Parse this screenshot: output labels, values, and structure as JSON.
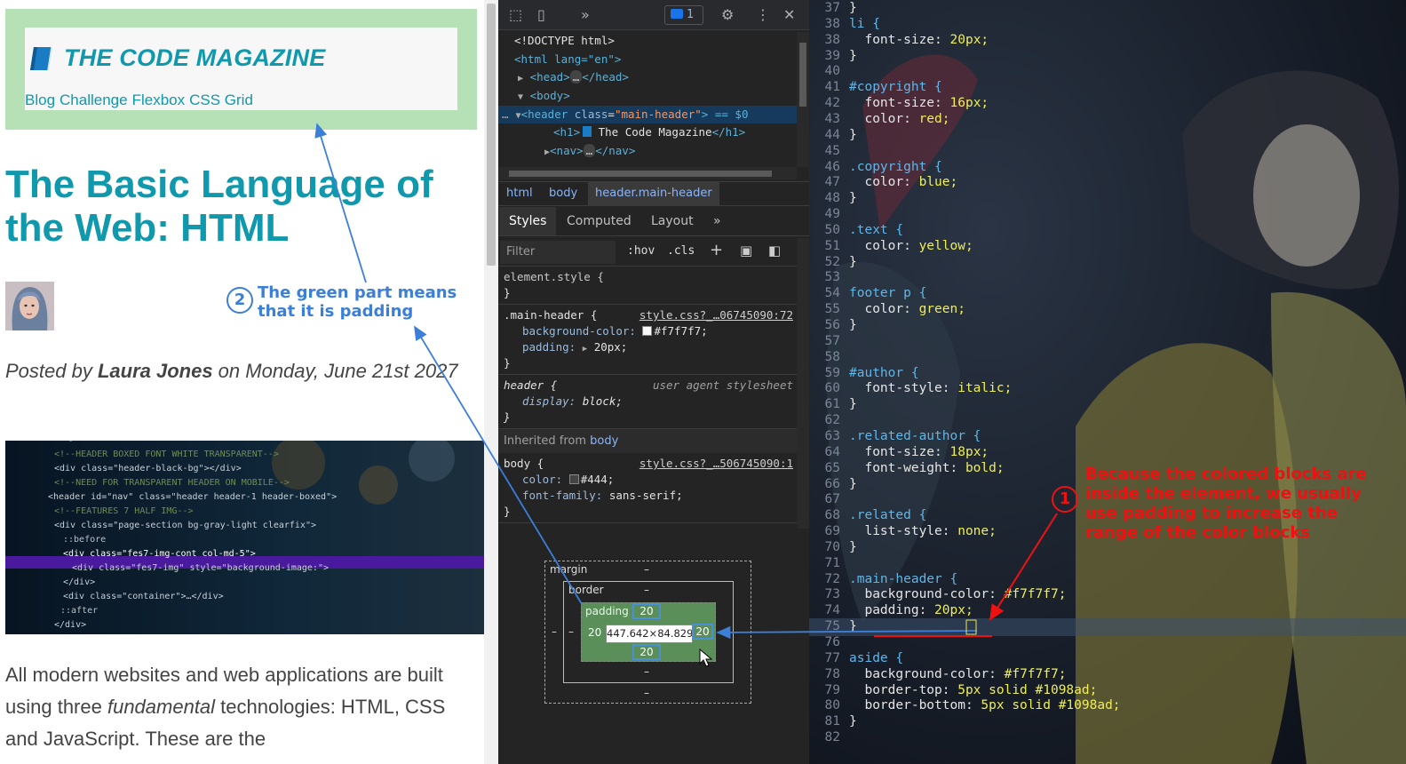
{
  "page": {
    "logo_text": "THE CODE MAGAZINE",
    "nav": [
      "Blog",
      "Challenge",
      "Flexbox",
      "CSS Grid"
    ],
    "title": "The Basic Language of the Web: HTML",
    "posted_prefix": "Posted by ",
    "author": "Laura Jones",
    "posted_suffix": " on Monday, June 21st 2027",
    "body_pre": "All modern websites and web applications are built using three ",
    "body_em": "fundamental",
    "body_post": " technologies: HTML, CSS and JavaScript. These are the",
    "code_image_lines": [
      "-->",
      "<!--HEADER BOXED FONT WHITE TRANSPARENT-->",
      "<div class=\"header-black-bg\"></div>",
      "<!--NEED FOR TRANSPARENT HEADER ON MOBILE-->",
      "<header id=\"nav\" class=\"header header-1 header-boxed\">",
      "<!--FEATURES 7 HALF IMG-->",
      "<div class=\"page-section bg-gray-light clearfix\">",
      "::before",
      "<div class=\"fes7-img-cont col-md-5\">",
      "<div class=\"fes7-img\" style=\"background-image:\">",
      "</div>",
      "<div class=\"container\">…</div>",
      "::after",
      "</div>"
    ]
  },
  "devtools": {
    "issues_count": "1",
    "dom": {
      "doctype": "<!DOCTYPE html>",
      "html_open": "<html lang=\"en\">",
      "head": "<head>",
      "head_close": "</head>",
      "body_open": "<body>",
      "header_tag": "<header",
      "header_attr_name": "class",
      "header_attr_value": "\"main-header\"",
      "header_suffix": "> == $0",
      "h1_open": "<h1>",
      "h1_text": " The Code Magazine",
      "h1_close": "</h1>",
      "nav_open": "<nav>",
      "nav_close": "</nav>",
      "ellipsis": "…"
    },
    "breadcrumbs": [
      "html",
      "body",
      "header.main-header"
    ],
    "tabs": [
      "Styles",
      "Computed",
      "Layout"
    ],
    "filter_placeholder": "Filter",
    "hov": ":hov",
    "cls": ".cls",
    "rules": {
      "element_style": "element.style {",
      "main_header_selector": ".main-header {",
      "main_header_src": "style.css?_…06745090:72",
      "bg_prop": "background-color:",
      "bg_val": "#f7f7f7;",
      "padding_prop": "padding:",
      "padding_val": "20px;",
      "header_selector": "header {",
      "ua_label": "user agent stylesheet",
      "display_prop": "display:",
      "display_val": "block;",
      "inherited_label": "Inherited from ",
      "inherited_from": "body",
      "body_selector": "body {",
      "body_src": "style.css?_…506745090:1",
      "color_prop": "color:",
      "color_val": "#444;",
      "font_prop": "font-family:",
      "font_val": "sans-serif;",
      "close_brace": "}"
    },
    "box_model": {
      "margin_label": "margin",
      "border_label": "border",
      "padding_label": "padding",
      "dash": "–",
      "padding_top": "20",
      "padding_left": "20",
      "padding_right": "20",
      "padding_bottom": "20",
      "content_size": "447.642×84.829"
    }
  },
  "editor": {
    "lines": [
      {
        "n": "37",
        "text": "}"
      },
      {
        "n": "38",
        "text": "li {"
      },
      {
        "n": "38",
        "text": "  font-size: 20px;"
      },
      {
        "n": "39",
        "text": "}"
      },
      {
        "n": "40",
        "text": ""
      },
      {
        "n": "41",
        "text": "#copyright {"
      },
      {
        "n": "42",
        "text": "  font-size: 16px;"
      },
      {
        "n": "43",
        "text": "  color: red;"
      },
      {
        "n": "44",
        "text": "}"
      },
      {
        "n": "45",
        "text": ""
      },
      {
        "n": "46",
        "text": ".copyright {"
      },
      {
        "n": "47",
        "text": "  color: blue;"
      },
      {
        "n": "48",
        "text": "}"
      },
      {
        "n": "49",
        "text": ""
      },
      {
        "n": "50",
        "text": ".text {"
      },
      {
        "n": "51",
        "text": "  color: yellow;"
      },
      {
        "n": "52",
        "text": "}"
      },
      {
        "n": "53",
        "text": ""
      },
      {
        "n": "54",
        "text": "footer p {"
      },
      {
        "n": "55",
        "text": "  color: green;"
      },
      {
        "n": "56",
        "text": "}"
      },
      {
        "n": "57",
        "text": ""
      },
      {
        "n": "58",
        "text": ""
      },
      {
        "n": "59",
        "text": "#author {"
      },
      {
        "n": "60",
        "text": "  font-style: italic;"
      },
      {
        "n": "61",
        "text": "}"
      },
      {
        "n": "62",
        "text": ""
      },
      {
        "n": "63",
        "text": ".related-author {"
      },
      {
        "n": "64",
        "text": "  font-size: 18px;"
      },
      {
        "n": "65",
        "text": "  font-weight: bold;"
      },
      {
        "n": "66",
        "text": "}"
      },
      {
        "n": "67",
        "text": ""
      },
      {
        "n": "68",
        "text": ".related {"
      },
      {
        "n": "69",
        "text": "  list-style: none;"
      },
      {
        "n": "70",
        "text": "}"
      },
      {
        "n": "71",
        "text": ""
      },
      {
        "n": "72",
        "text": ".main-header {"
      },
      {
        "n": "73",
        "text": "  background-color: #f7f7f7;"
      },
      {
        "n": "74",
        "text": "  padding: 20px;"
      },
      {
        "n": "75",
        "text": "}"
      },
      {
        "n": "76",
        "text": ""
      },
      {
        "n": "77",
        "text": "aside {"
      },
      {
        "n": "78",
        "text": "  background-color: #f7f7f7;"
      },
      {
        "n": "79",
        "text": "  border-top: 5px solid #1098ad;"
      },
      {
        "n": "80",
        "text": "  border-bottom: 5px solid #1098ad;"
      },
      {
        "n": "81",
        "text": "}"
      },
      {
        "n": "82",
        "text": ""
      }
    ]
  },
  "annotations": {
    "blue_number": "2",
    "blue_text_1": "The green part means",
    "blue_text_2": "that it is padding",
    "red_number": "1",
    "red_text_1": "Because the colored blocks are",
    "red_text_2": "inside the element, we usually",
    "red_text_3": "use padding to increase the",
    "red_text_4": "range of the color blocks"
  },
  "colors": {
    "accent": "#1098ad",
    "annotation_blue": "#3b7fd9",
    "annotation_red": "#ee1111",
    "padding_green": "#5a8f5a"
  }
}
